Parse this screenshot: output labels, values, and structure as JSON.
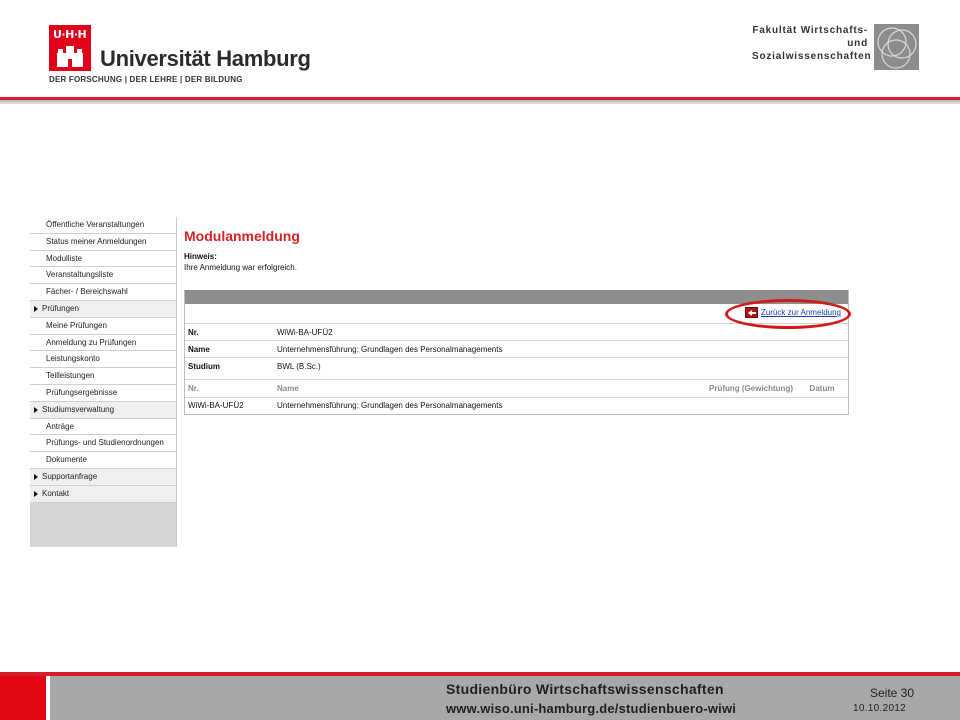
{
  "header": {
    "logo_text": "U·H·H",
    "university": "Universität Hamburg",
    "motto": "DER FORSCHUNG | DER LEHRE | DER BILDUNG",
    "faculty_line1": "Fakultät Wirtschafts- und",
    "faculty_line2": "Sozialwissenschaften"
  },
  "sidebar": {
    "items": [
      {
        "label": "Öffentliche Veranstaltungen",
        "level": "sub"
      },
      {
        "label": "Status meiner Anmeldungen",
        "level": "sub"
      },
      {
        "label": "Modulliste",
        "level": "sub"
      },
      {
        "label": "Veranstaltungsliste",
        "level": "sub"
      },
      {
        "label": "Fächer- / Bereichswahl",
        "level": "sub"
      },
      {
        "label": "Prüfungen",
        "level": "top"
      },
      {
        "label": "Meine Prüfungen",
        "level": "sub"
      },
      {
        "label": "Anmeldung zu Prüfungen",
        "level": "sub"
      },
      {
        "label": "Leistungskonto",
        "level": "sub"
      },
      {
        "label": "Teilleistungen",
        "level": "sub"
      },
      {
        "label": "Prüfungsergebnisse",
        "level": "sub"
      },
      {
        "label": "Studiumsverwaltung",
        "level": "top"
      },
      {
        "label": "Anträge",
        "level": "sub"
      },
      {
        "label": "Prüfungs- und Studienordnungen",
        "level": "sub"
      },
      {
        "label": "Dokumente",
        "level": "sub"
      },
      {
        "label": "Supportanfrage",
        "level": "top"
      },
      {
        "label": "Kontakt",
        "level": "top"
      }
    ]
  },
  "main": {
    "title": "Modulanmeldung",
    "hint_label": "Hinweis:",
    "hint_text": "Ihre Anmeldung war erfolgreich.",
    "back_link": "Zurück zur Anmeldung",
    "info": [
      {
        "key": "Nr.",
        "value": "WiWi-BA-UFÜ2"
      },
      {
        "key": "Name",
        "value": "Unternehmensführung: Grundlagen des Personalmanagements"
      },
      {
        "key": "Studium",
        "value": "BWL (B.Sc.)"
      }
    ],
    "columns": {
      "nr": "Nr.",
      "name": "Name",
      "pruefung": "Prüfung (Gewichtung)",
      "datum": "Datum"
    },
    "rows": [
      {
        "nr": "WiWi-BA-UFÜ2",
        "name": "Unternehmensführung: Grundlagen des Personalmanagements",
        "pruefung": "",
        "datum": ""
      }
    ]
  },
  "footer": {
    "title": "Studienbüro Wirtschaftswissenschaften",
    "url": "www.wiso.uni-hamburg.de/studienbuero-wiwi",
    "page_label": "Seite 30",
    "date": "10.10.2012"
  },
  "colors": {
    "accent_red": "#e2001a",
    "link_blue": "#1a3fb0",
    "footer_grey": "#a8a8a8"
  }
}
